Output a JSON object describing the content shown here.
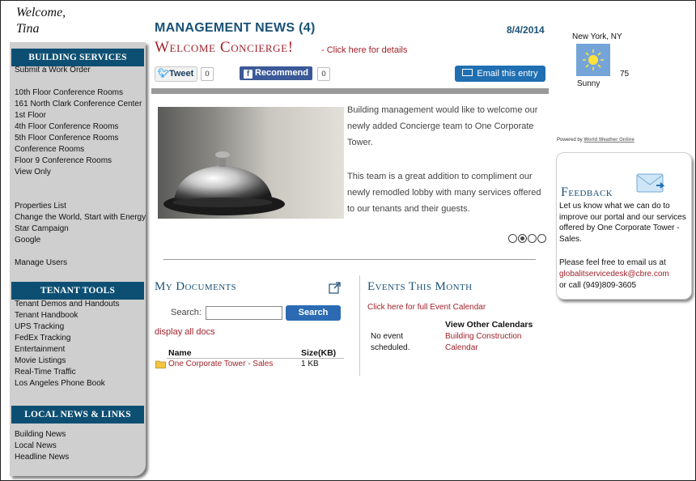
{
  "welcome": {
    "line1": "Welcome,",
    "line2": "Tina"
  },
  "sidebar": {
    "building_services": {
      "title": "BUILDING SERVICES",
      "items": [
        "Submit a Work Order",
        "10th Floor Conference Rooms",
        "161 North Clark Conference Center",
        "1st Floor",
        "4th Floor Conference Rooms",
        "5th Floor Conference Rooms",
        "Conference Rooms",
        "Floor 9 Conference Rooms",
        "View Only",
        "Properties List",
        "Change the World, Start with Energy",
        "Star Campaign",
        "Google",
        "Manage Users"
      ]
    },
    "tenant_tools": {
      "title": "TENANT TOOLS",
      "items": [
        "Tenant Demos and Handouts",
        "Tenant Handbook",
        "UPS Tracking",
        "FedEx Tracking",
        "Entertainment",
        "Movie Listings",
        "Real-Time Traffic",
        "Los Angeles Phone Book"
      ]
    },
    "local_news": {
      "title": "LOCAL NEWS & LINKS",
      "items": [
        "Building News",
        "Local News",
        "Headline News"
      ]
    }
  },
  "news": {
    "title": "MANAGEMENT NEWS (4)",
    "date": "8/4/2014",
    "headline": "Welcome Concierge!",
    "details_link": "- Click here for details",
    "tweet_label": "Tweet",
    "tweet_count": "0",
    "recommend_label": "Recommend",
    "recommend_count": "0",
    "email_label": "Email this entry",
    "paragraph1": "Building management would like to welcome our newly added Concierge team to One Corporate Tower.",
    "paragraph2": "This team is a great addition to compliment our newly remodled lobby with many services offered to our tenants and their guests."
  },
  "documents": {
    "title": "My Documents",
    "search_label": "Search:",
    "search_value": "",
    "search_button": "Search",
    "display_all": "display all docs",
    "col_name": "Name",
    "col_size": "Size(KB)",
    "rows": [
      {
        "name": "One Corporate Tower - Sales",
        "size": "1 KB"
      }
    ]
  },
  "events": {
    "title": "Events This Month",
    "calendar_link": "Click here for full Event Calendar",
    "no_event": "No event scheduled.",
    "other_header": "View Other Calendars",
    "other_link": "Building Construction Calendar"
  },
  "weather": {
    "location": "New York, NY",
    "temp": "75",
    "condition": "Sunny",
    "powered_by": "Powered by",
    "powered_link": "World Weather Online",
    "icon": "sun-icon"
  },
  "feedback": {
    "title": "Feedback",
    "text1": "Let us know what we can do to improve our portal and our services offered by One Corporate Tower - Sales.",
    "text2": "Please feel free to email us at",
    "email": "globalitservicedesk@cbre.com",
    "phone": "or call (949)809-3605",
    "icon": "envelope-icon"
  },
  "colors": {
    "navy": "#0d4f73",
    "title_blue": "#1a5277",
    "red": "#a1232c",
    "sidebar_gray": "#cfcfcf"
  }
}
